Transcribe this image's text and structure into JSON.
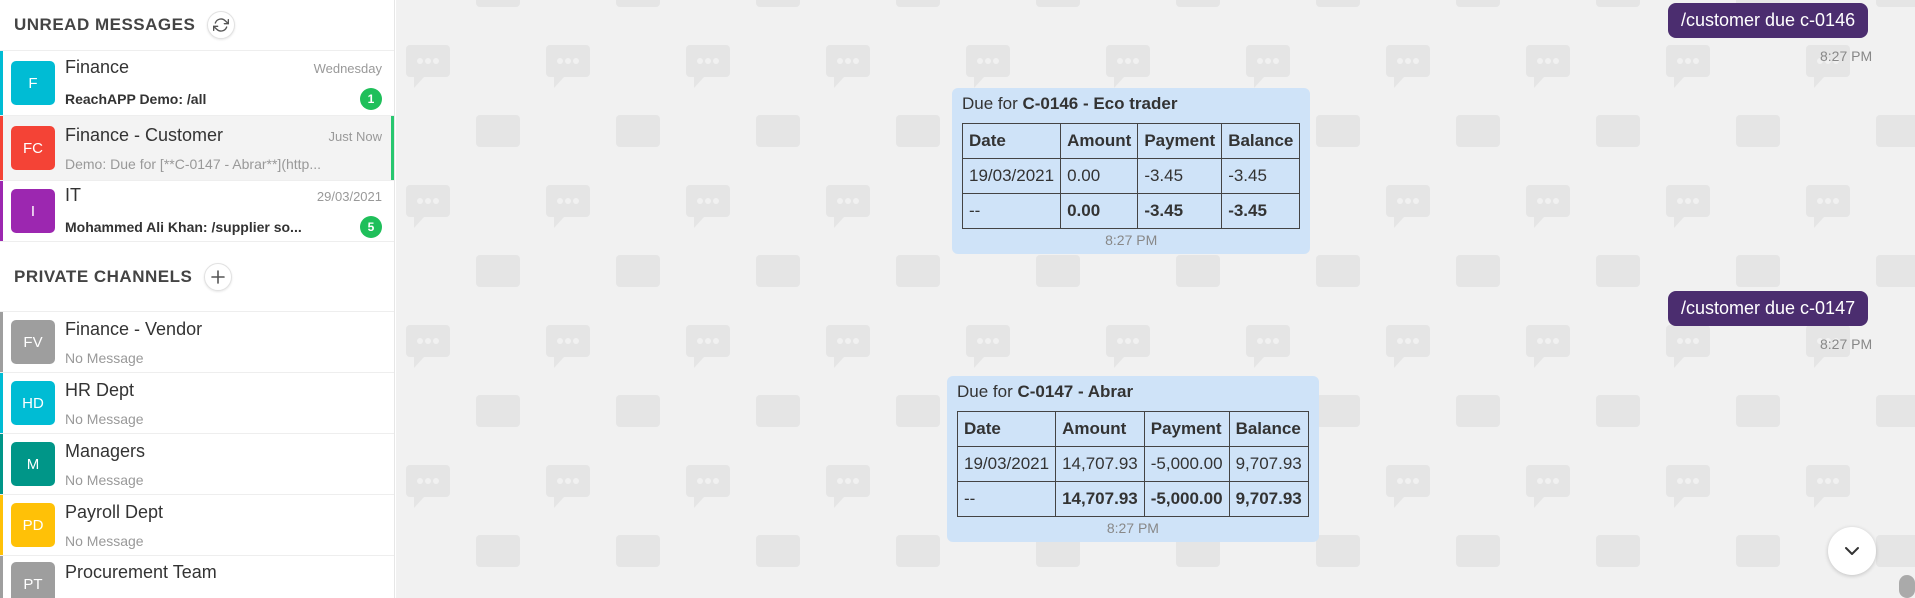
{
  "sidebar": {
    "unread_title": "UNREAD MESSAGES",
    "private_title": "PRIVATE CHANNELS",
    "unread": [
      {
        "initials": "F",
        "name": "Finance",
        "time": "Wednesday",
        "preview": "ReachAPP Demo: /all",
        "badge": "1",
        "color": "#00bcd4"
      },
      {
        "initials": "FC",
        "name": "Finance - Customer",
        "time": "Just Now",
        "preview": "Demo: Due for [**C-0147 - Abrar**](http...",
        "color": "#f44336"
      },
      {
        "initials": "I",
        "name": "IT",
        "time": "29/03/2021",
        "preview": "Mohammed Ali Khan: /supplier so...",
        "badge": "5",
        "color": "#9c27b0"
      }
    ],
    "private": [
      {
        "initials": "FV",
        "name": "Finance - Vendor",
        "preview": "No Message",
        "color": "#9e9e9e"
      },
      {
        "initials": "HD",
        "name": "HR Dept",
        "preview": "No Message",
        "color": "#00bcd4"
      },
      {
        "initials": "M",
        "name": "Managers",
        "preview": "No Message",
        "color": "#009688"
      },
      {
        "initials": "PD",
        "name": "Payroll Dept",
        "preview": "No Message",
        "color": "#ffc107"
      },
      {
        "initials": "PT",
        "name": "Procurement Team",
        "preview": "",
        "color": "#9e9e9e"
      }
    ]
  },
  "chat": {
    "messages": [
      {
        "text": "/customer due c-0146",
        "time": "8:27 PM"
      },
      {
        "text": "/customer due c-0147",
        "time": "8:27 PM"
      }
    ],
    "cards": [
      {
        "title_prefix": "Due for",
        "title_bold": "C-0146 - Eco trader",
        "headers": [
          "Date",
          "Amount",
          "Payment",
          "Balance"
        ],
        "row": [
          "19/03/2021",
          "0.00",
          "-3.45",
          "-3.45"
        ],
        "total": [
          "--",
          "0.00",
          "-3.45",
          "-3.45"
        ],
        "time": "8:27 PM"
      },
      {
        "title_prefix": "Due for",
        "title_bold": "C-0147 - Abrar",
        "headers": [
          "Date",
          "Amount",
          "Payment",
          "Balance"
        ],
        "row": [
          "19/03/2021",
          "14,707.93",
          "-5,000.00",
          "9,707.93"
        ],
        "total": [
          "--",
          "14,707.93",
          "-5,000.00",
          "9,707.93"
        ],
        "time": "8:27 PM"
      }
    ]
  },
  "icons": {
    "refresh": "refresh-icon",
    "add": "plus-icon",
    "scroll_down": "chevron-down-icon"
  }
}
